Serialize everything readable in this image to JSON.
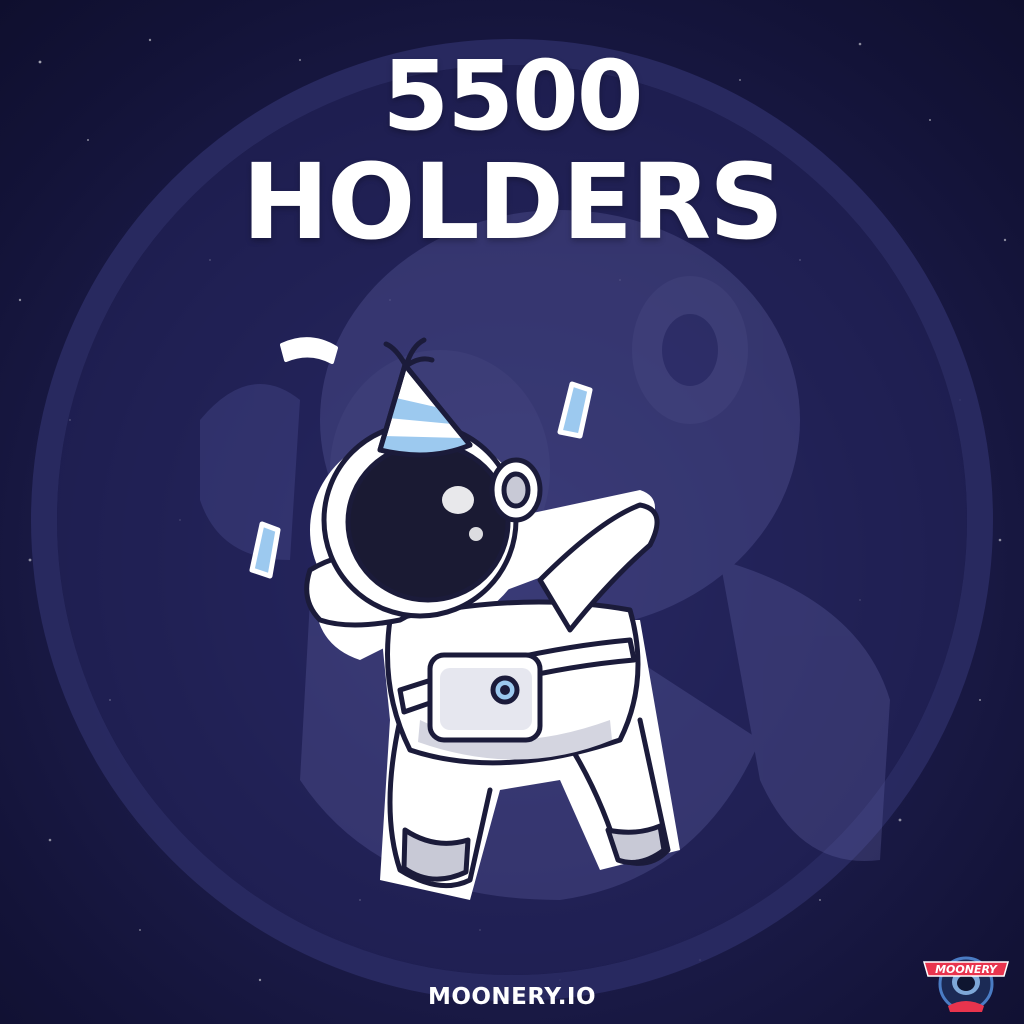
{
  "headline": {
    "number": "5500",
    "label": "HOLDERS"
  },
  "footer": {
    "url": "MOONERY.IO"
  },
  "brand": {
    "logo_text": "MOONERY"
  },
  "icons": {
    "mascot": "dabbing-astronaut-with-party-hat",
    "background": "ghosted-astronaut-in-circle",
    "logo": "moonery-astronaut-badge"
  },
  "colors": {
    "background": "#1b1b48",
    "circle": "#30316a",
    "text": "#ffffff",
    "accent_blue": "#9cc9ef",
    "logo_red": "#e8344d"
  }
}
